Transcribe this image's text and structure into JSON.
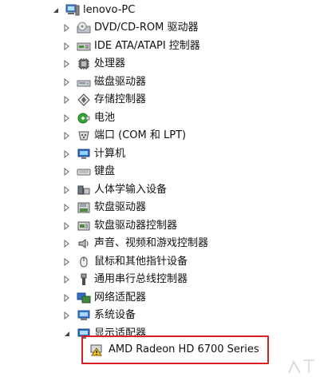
{
  "tree": {
    "root_label": "lenovo-PC",
    "items": [
      {
        "label": "DVD/CD-ROM 驱动器",
        "icon": "dvd-drive-icon"
      },
      {
        "label": "IDE ATA/ATAPI 控制器",
        "icon": "ide-controller-icon"
      },
      {
        "label": "处理器",
        "icon": "processor-icon"
      },
      {
        "label": "磁盘驱动器",
        "icon": "disk-drive-icon"
      },
      {
        "label": "存储控制器",
        "icon": "storage-controller-icon"
      },
      {
        "label": "电池",
        "icon": "battery-icon"
      },
      {
        "label": "端口 (COM 和 LPT)",
        "icon": "port-icon"
      },
      {
        "label": "计算机",
        "icon": "computer-icon"
      },
      {
        "label": "键盘",
        "icon": "keyboard-icon"
      },
      {
        "label": "人体学输入设备",
        "icon": "hid-icon"
      },
      {
        "label": "软盘驱动器",
        "icon": "floppy-drive-icon"
      },
      {
        "label": "软盘驱动器控制器",
        "icon": "floppy-controller-icon"
      },
      {
        "label": "声音、视频和游戏控制器",
        "icon": "sound-icon"
      },
      {
        "label": "鼠标和其他指针设备",
        "icon": "mouse-icon"
      },
      {
        "label": "通用串行总线控制器",
        "icon": "usb-icon"
      },
      {
        "label": "网络适配器",
        "icon": "network-adapter-icon"
      },
      {
        "label": "系统设备",
        "icon": "system-device-icon"
      },
      {
        "label": "显示适配器",
        "icon": "display-adapter-icon"
      }
    ],
    "child_device": {
      "label": "AMD Radeon HD 6700 Series",
      "icon": "warning-display-icon"
    }
  },
  "colors": {
    "highlight_border": "#d91e24",
    "text": "#111111",
    "expander": "#555555"
  }
}
